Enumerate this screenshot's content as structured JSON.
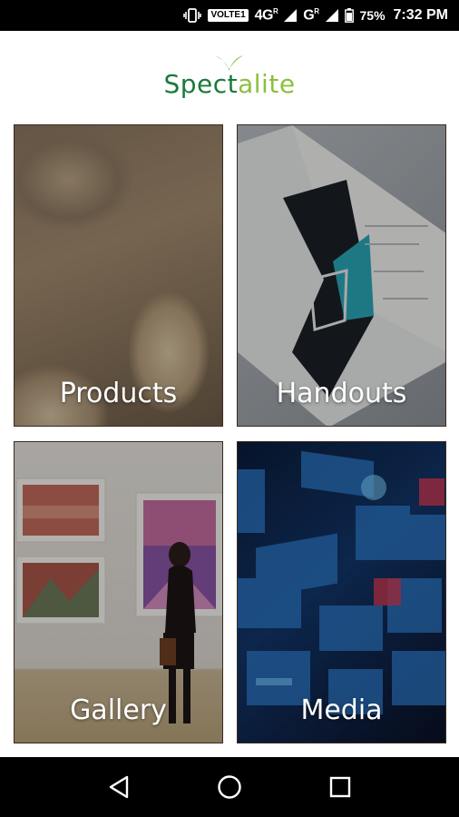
{
  "status_bar": {
    "volte": "VOLTE1",
    "network1": "4G",
    "network1_sup": "R",
    "network2": "G",
    "network2_sup": "R",
    "battery_percent": "75%",
    "time": "7:32 PM",
    "icons": [
      "vibrate-icon",
      "signal-icon",
      "signal-icon",
      "battery-icon"
    ]
  },
  "header": {
    "logo_part1": "Spect",
    "logo_part2": "a",
    "logo_part3": "lite",
    "colors": {
      "primary": "#1a7a3a",
      "accent": "#8cbf3f"
    }
  },
  "tiles": [
    {
      "label": "Products"
    },
    {
      "label": "Handouts"
    },
    {
      "label": "Gallery"
    },
    {
      "label": "Media"
    }
  ],
  "nav_bar": {
    "icons": [
      "back-icon",
      "home-icon",
      "recents-icon"
    ]
  }
}
